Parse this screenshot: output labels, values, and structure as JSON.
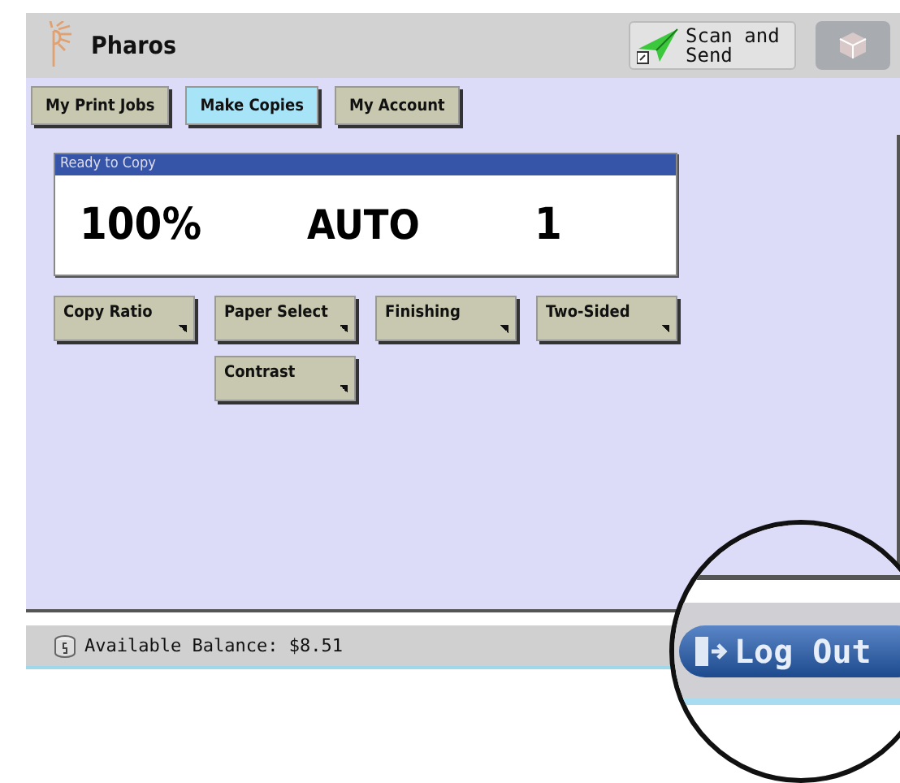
{
  "header": {
    "title": "Pharos",
    "scan_button": "Scan and Send"
  },
  "tabs": [
    {
      "label": "My Print Jobs",
      "selected": false
    },
    {
      "label": "Make Copies",
      "selected": true
    },
    {
      "label": "My Account",
      "selected": false
    }
  ],
  "display": {
    "title": "Ready to Copy",
    "ratio": "100%",
    "paper": "AUTO",
    "copies": "1"
  },
  "option_rows": [
    [
      "Copy Ratio",
      "Paper Select",
      "Finishing",
      "Two-Sided"
    ],
    [
      null,
      "Contrast"
    ]
  ],
  "status_bar": {
    "balance": "Available Balance: $8.51"
  },
  "magnifier": {
    "button": "Log Out"
  }
}
